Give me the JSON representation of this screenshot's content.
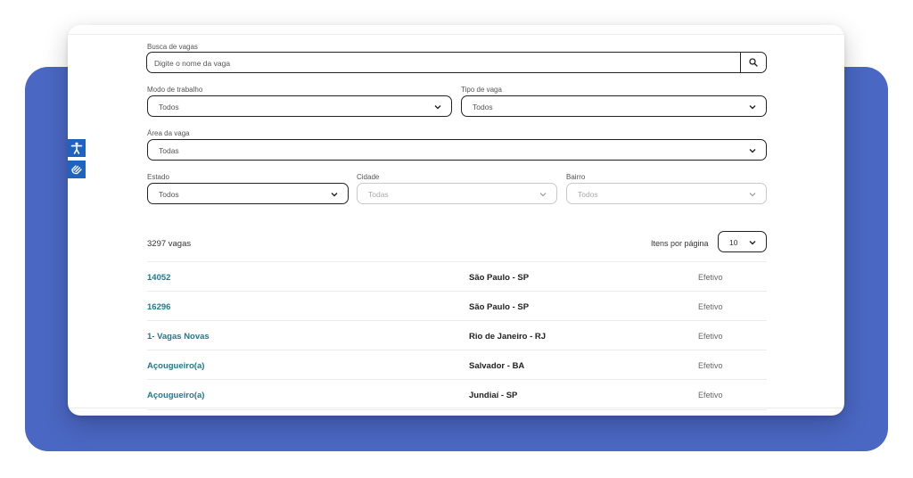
{
  "search": {
    "label": "Busca de vagas",
    "placeholder": "Digite o nome da vaga"
  },
  "filters": {
    "work_mode": {
      "label": "Modo de trabalho",
      "value": "Todos"
    },
    "job_type": {
      "label": "Tipo de vaga",
      "value": "Todos"
    },
    "area": {
      "label": "Área da vaga",
      "value": "Todas"
    },
    "state": {
      "label": "Estado",
      "value": "Todos"
    },
    "city": {
      "label": "Cidade",
      "value": "Todas"
    },
    "neighborhood": {
      "label": "Bairro",
      "value": "Todos"
    }
  },
  "results": {
    "count_text": "3297 vagas",
    "per_page_label": "Itens por página",
    "per_page_value": "10"
  },
  "jobs": [
    {
      "title": "14052",
      "location": "São Paulo - SP",
      "type": "Efetivo"
    },
    {
      "title": "16296",
      "location": "São Paulo - SP",
      "type": "Efetivo"
    },
    {
      "title": "1- Vagas Novas",
      "location": "Rio de Janeiro - RJ",
      "type": "Efetivo"
    },
    {
      "title": "Açougueiro(a)",
      "location": "Salvador - BA",
      "type": "Efetivo"
    },
    {
      "title": "Açougueiro(a)",
      "location": "Jundiaí - SP",
      "type": "Efetivo"
    }
  ],
  "accessibility": {
    "icons": [
      "accessibility-icon",
      "sign-language-icon"
    ]
  },
  "colors": {
    "accent_blue": "#4a67c3",
    "link_teal": "#1f7a8c",
    "access_blue": "#1f63c0"
  }
}
